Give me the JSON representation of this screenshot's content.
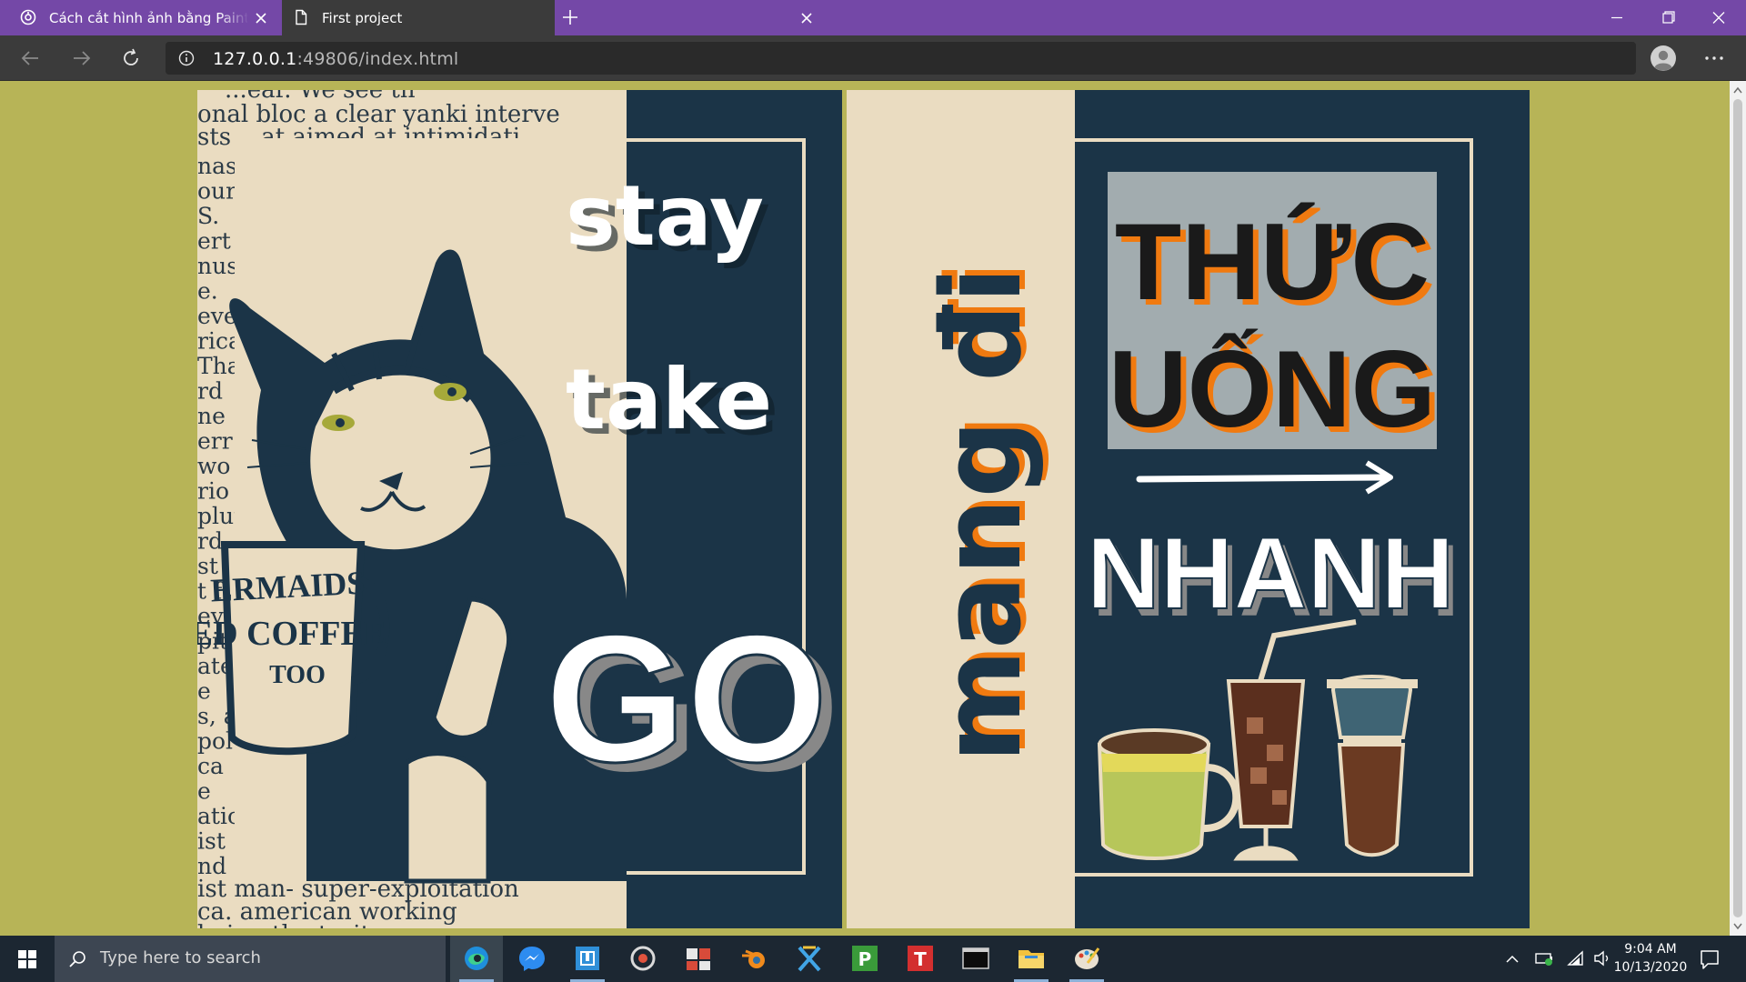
{
  "browser": {
    "tabs": [
      {
        "title": "Cách cắt hình ảnh bằng Paint - Cả",
        "active": false,
        "icon": "site-favicon"
      },
      {
        "title": "First project",
        "active": true,
        "icon": "document-icon"
      }
    ],
    "address": {
      "host": "127.0.0.1",
      "rest": ":49806/index.html"
    },
    "accent_color": "#7448a7",
    "toolbar_color": "#3b3b3b"
  },
  "page": {
    "background": "#b7b457",
    "poster_left": {
      "lines": [
        "stay",
        "take",
        "GO"
      ],
      "mug_text": [
        "ERMAIDS",
        "ED COFFEE",
        "TOO"
      ],
      "newspaper": {
        "top_lines": [
          "...ear. We see th",
          "onal bloc  a clear yanki interve",
          "sts ...at aimed at intimidati"
        ],
        "left_fragments": [
          "nas",
          "our",
          "S.",
          "ert",
          "nus",
          "e.",
          "eve",
          "rica",
          "Tha",
          "rd",
          "ne",
          "err",
          "wo",
          "rio",
          "plut",
          "rd",
          "st g",
          "t fo",
          "eve",
          "pite",
          "ate",
          "e",
          "s, a",
          "pol",
          "ca",
          "e",
          "atic",
          "ist",
          "nd"
        ],
        "bottom_lines": [
          "ist  man-  super-exploitation",
          "ca.        american  working",
          "           being   the   trait"
        ]
      }
    },
    "poster_right": {
      "vertical_text": "mang đi",
      "headline": [
        "THỨC",
        "UỐNG"
      ],
      "subline": "NHANH"
    }
  },
  "taskbar": {
    "search_placeholder": "Type here to search",
    "apps": [
      "edge-icon",
      "messenger-icon",
      "app-box-icon",
      "media-disc-icon",
      "office-tools-icon",
      "blender-icon",
      "cross-app-icon",
      "project-icon",
      "t-app-icon",
      "terminal-icon",
      "file-explorer-icon",
      "paint-icon"
    ],
    "time": "9:04 AM",
    "date": "10/13/2020"
  }
}
